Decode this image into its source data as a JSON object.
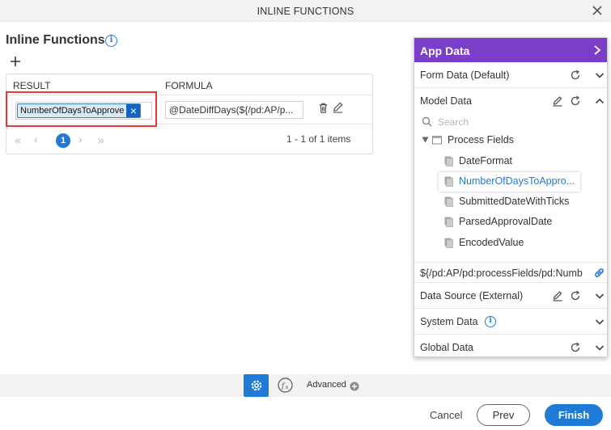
{
  "window": {
    "title": "INLINE FUNCTIONS"
  },
  "main": {
    "title": "Inline Functions",
    "columns": {
      "result": "RESULT",
      "formula": "FORMULA"
    },
    "row": {
      "result_token": "NumberOfDaysToApprove",
      "formula": "@DateDiffDays(${/pd:AP/p..."
    },
    "pager": {
      "current_page": "1",
      "items_info": "1 - 1 of 1 items"
    }
  },
  "app_data": {
    "title": "App Data",
    "sections": {
      "form_data": "Form Data (Default)",
      "model_data": "Model Data",
      "data_source": "Data Source (External)",
      "system_data": "System Data",
      "global_data": "Global Data"
    },
    "search_placeholder": "Search",
    "tree": {
      "root": "Process Fields",
      "fields": [
        "DateFormat",
        "NumberOfDaysToAppro...",
        "SubmittedDateWithTicks",
        "ParsedApprovalDate",
        "EncodedValue"
      ]
    },
    "selected_path": "${/pd:AP/pd:processFields/pd:Numb"
  },
  "toolbar": {
    "advanced_label": "Advanced"
  },
  "footer": {
    "cancel": "Cancel",
    "prev": "Prev",
    "finish": "Finish"
  },
  "colors": {
    "accent": "#1f7bd6",
    "panel_header": "#7b3ec8",
    "highlight": "#e53935",
    "selected_field": "#1f7bd6"
  },
  "icons": [
    "close-icon",
    "info-icon",
    "plus-icon",
    "delete-icon",
    "edit-icon",
    "refresh-icon",
    "chevron-down-icon",
    "chevron-up-icon",
    "chevron-right-icon",
    "search-icon",
    "link-icon",
    "gear-icon",
    "fx-icon",
    "plus-circle-icon"
  ]
}
